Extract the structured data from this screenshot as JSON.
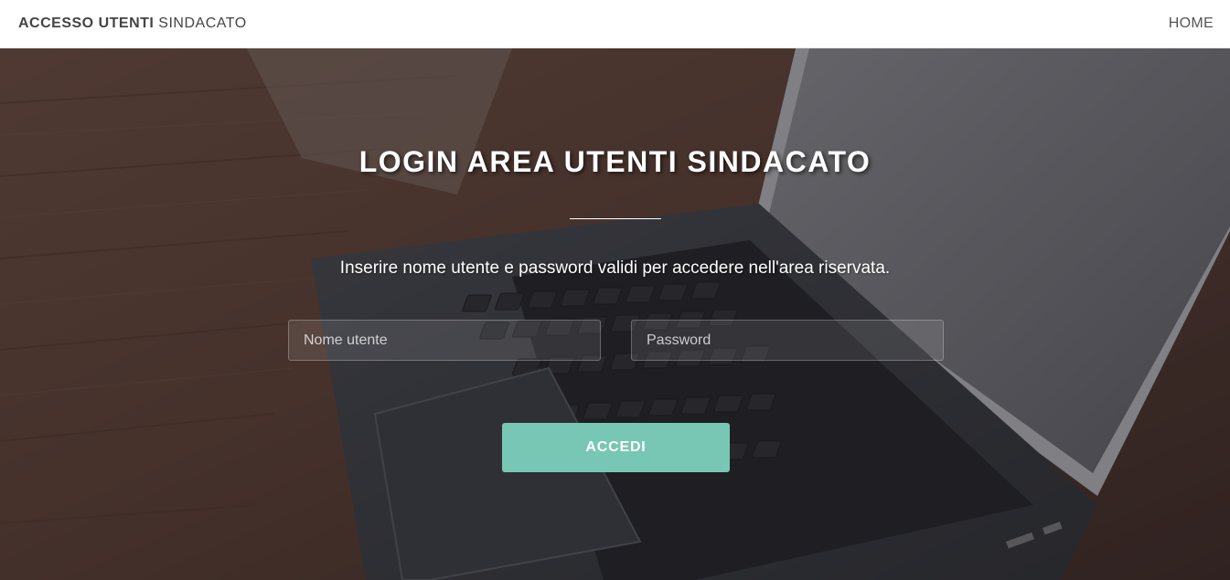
{
  "navbar": {
    "brand_bold": "ACCESSO UTENTI",
    "brand_rest": "SINDACATO",
    "home_label": "HOME"
  },
  "hero": {
    "title": "LOGIN AREA UTENTI SINDACATO",
    "instructions": "Inserire nome utente e password validi per accedere nell'area riservata."
  },
  "form": {
    "username_placeholder": "Nome utente",
    "username_value": "",
    "password_placeholder": "Password",
    "password_value": "",
    "submit_label": "ACCEDI"
  },
  "colors": {
    "accent": "#78c7b5",
    "navbar_bg": "#ffffff",
    "text_light": "#ffffff",
    "brand_text": "#444444"
  },
  "icons": {
    "background_image": "laptop-on-wooden-desk-photo"
  }
}
